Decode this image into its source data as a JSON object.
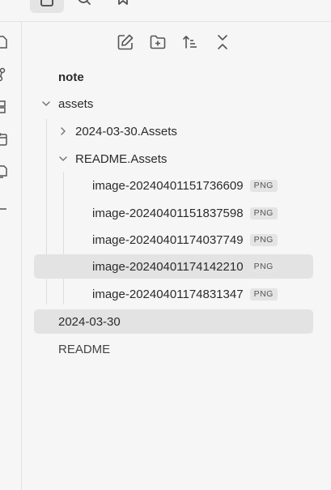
{
  "colors": {
    "background": "#f6f6f6",
    "selected": "#e3e3e3",
    "icon": "#555555",
    "badge_bg": "#e4e4e4"
  },
  "top_icons": [
    "files-icon",
    "search-icon",
    "bookmark-icon"
  ],
  "ribbon_icons": [
    "file-icon",
    "graph-icon",
    "canvas-icon",
    "calendar-icon",
    "copy-icon",
    "minus-icon"
  ],
  "actions": [
    "new-note-icon",
    "new-folder-icon",
    "sort-icon",
    "collapse-icon"
  ],
  "tree": {
    "root": "note",
    "assets": "assets",
    "folder_1": "2024-03-30.Assets",
    "folder_2": "README.Assets",
    "files": [
      {
        "name": "image-20240401151736609",
        "ext": "PNG"
      },
      {
        "name": "image-20240401151837598",
        "ext": "PNG"
      },
      {
        "name": "image-20240401174037749",
        "ext": "PNG"
      },
      {
        "name": "image-20240401174142210",
        "ext": "PNG"
      },
      {
        "name": "image-20240401174831347",
        "ext": "PNG"
      }
    ],
    "note_1": "2024-03-30",
    "note_2": "README"
  }
}
